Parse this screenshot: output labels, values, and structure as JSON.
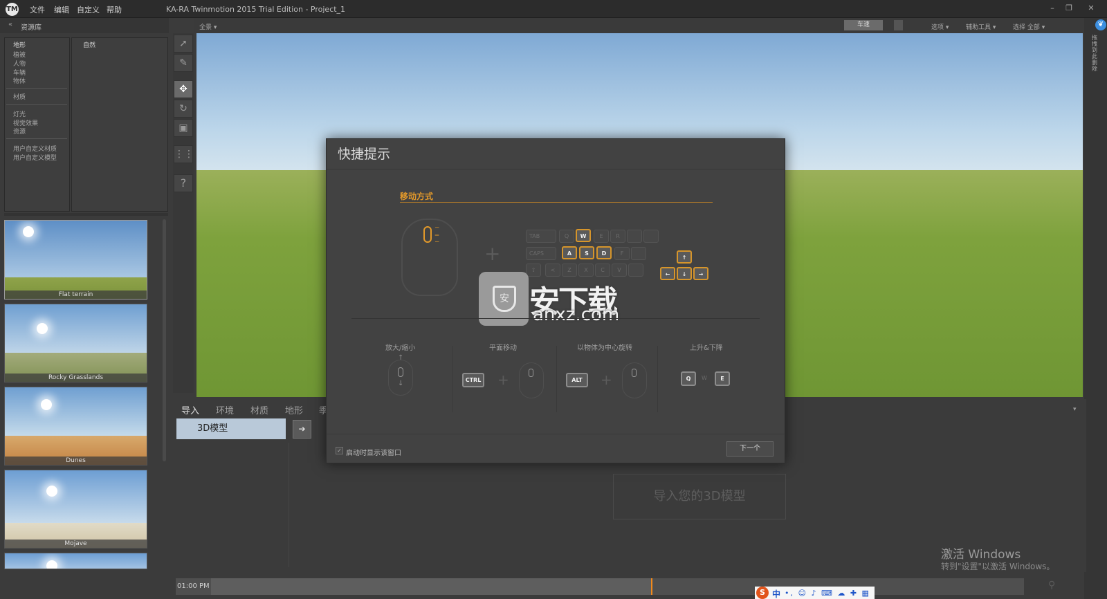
{
  "app": {
    "logo": "TM",
    "title": "KA-RA Twinmotion 2015 Trial Edition - Project_1",
    "menu": [
      "文件",
      "编辑",
      "自定义",
      "帮助"
    ],
    "window_controls": [
      "–",
      "❐",
      "✕"
    ]
  },
  "library": {
    "back_arrow": "«",
    "title": "资源库",
    "col1_header": "地形",
    "col2_header": "自然",
    "categories": [
      "植被",
      "人物",
      "车辆",
      "物体",
      "材质",
      "灯光",
      "视觉效果",
      "资源",
      "用户自定义材质",
      "用户自定义模型"
    ],
    "presets": [
      {
        "label": "Flat terrain",
        "ground": "#8fa34a",
        "sky": "#8ab3d8"
      },
      {
        "label": "Rocky Grasslands",
        "ground": "#8e9c62",
        "sky": "#9bbfe0"
      },
      {
        "label": "Dunes",
        "ground": "#c99356",
        "sky": "#93bde2"
      },
      {
        "label": "Mojave",
        "ground": "#d2c8b0",
        "sky": "#8db4dc"
      },
      {
        "label": "",
        "ground": "#9fb9d6",
        "sky": "#8fb7df"
      }
    ]
  },
  "viewport": {
    "view_mode": "全景",
    "speed_label": "车速",
    "menus": [
      "选项",
      "辅助工具",
      "选择 全部"
    ]
  },
  "right_sidebar": {
    "icon": "❦",
    "text": "拖拽到此删除"
  },
  "tools": {
    "select": "➚",
    "brush": "✎",
    "move": "✥",
    "rotate": "↻",
    "scale": "▣",
    "grid": "⋮⋮",
    "help": "?"
  },
  "bottom": {
    "tabs": [
      "导入",
      "环境",
      "材质",
      "地形",
      "季"
    ],
    "model_item": "3D模型",
    "import_button": "➔",
    "drop_hint": "导入您的3D模型",
    "collapse_icon": "▾",
    "time": "01:00 PM",
    "windows_activation_title": "激活 Windows",
    "windows_activation_sub": "转到\"设置\"以激活 Windows。"
  },
  "ime": {
    "logo": "S",
    "lang": "中",
    "icons": "•, ☺ ♪ ⌨ ☁ ✚ ▦"
  },
  "dialog": {
    "title": "快捷提示",
    "section_title": "移动方式",
    "plus": "+",
    "keyboard": {
      "row1": [
        "TAB",
        "Q",
        "W",
        "E",
        "R",
        "",
        ""
      ],
      "row2": [
        "CAPS",
        "A",
        "S",
        "D",
        "F",
        ""
      ],
      "row3": [
        "⇧",
        "<",
        "Z",
        "X",
        "C",
        "V",
        ""
      ]
    },
    "highlight_keys": [
      "W",
      "A",
      "S",
      "D"
    ],
    "arrows": {
      "up": "↑",
      "left": "←",
      "down": "↓",
      "right": "→"
    },
    "zoom_arrows": {
      "up": "↑",
      "down": "↓"
    },
    "sections": [
      {
        "label": "放大/缩小"
      },
      {
        "label": "平面移动",
        "key": "CTRL"
      },
      {
        "label": "以物体为中心旋转",
        "key": "ALT"
      },
      {
        "label": "上升&下降",
        "keys": [
          "Q",
          "W",
          "E"
        ]
      }
    ],
    "checkbox_mark": "✓",
    "checkbox_label": "启动时显示该窗口",
    "next_button": "下一个"
  },
  "watermark": {
    "text": "安下载",
    "url": "anxz.com",
    "badge": "安"
  },
  "colors": {
    "accent": "#e49a2a",
    "timeline_marker": "#f28a1b",
    "model_item_bg": "#b9c9d9"
  }
}
